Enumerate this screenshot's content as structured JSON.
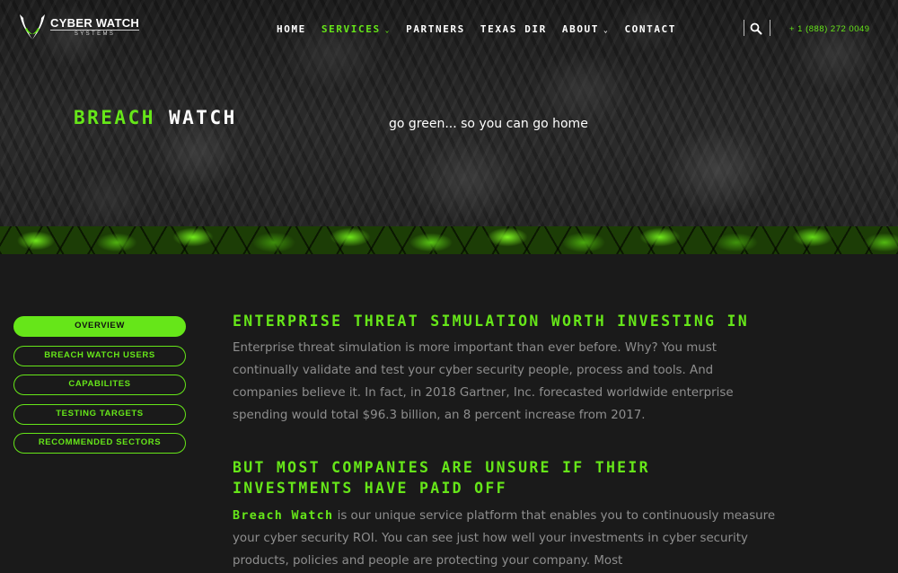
{
  "brand": {
    "name": "CYBER WATCH",
    "sub": "SYSTEMS",
    "accent": "#66e619"
  },
  "nav": {
    "items": [
      {
        "label": "HOME",
        "active": false,
        "dropdown": false
      },
      {
        "label": "SERVICES",
        "active": true,
        "dropdown": true
      },
      {
        "label": "PARTNERS",
        "active": false,
        "dropdown": false
      },
      {
        "label": "TEXAS DIR",
        "active": false,
        "dropdown": false
      },
      {
        "label": "ABOUT",
        "active": false,
        "dropdown": true
      },
      {
        "label": "CONTACT",
        "active": false,
        "dropdown": false
      }
    ],
    "search_icon": "search-icon",
    "phone": "+ 1 (888) 272 0049"
  },
  "hero": {
    "title_green": "BREACH",
    "title_white": "WATCH",
    "tagline": "go green... so you can go home"
  },
  "sidebar": {
    "items": [
      {
        "label": "OVERVIEW",
        "active": true
      },
      {
        "label": "BREACH WATCH USERS",
        "active": false
      },
      {
        "label": "CAPABILITES",
        "active": false
      },
      {
        "label": "TESTING TARGETS",
        "active": false
      },
      {
        "label": "RECOMMENDED SECTORS",
        "active": false
      }
    ]
  },
  "content": {
    "heading1": "ENTERPRISE THREAT SIMULATION WORTH INVESTING IN",
    "paragraph1": "Enterprise threat simulation is more important than ever before. Why? You must continually validate and test your cyber security people, process and tools. And companies believe it. In fact, in 2018 Gartner, Inc. forecasted worldwide enterprise spending would total $96.3 billion, an 8 percent increase from 2017.",
    "heading2_line1": "BUT MOST COMPANIES ARE UNSURE IF THEIR",
    "heading2_line2": "INVESTMENTS HAVE PAID OFF",
    "paragraph2_brand": "Breach Watch",
    "paragraph2": " is our unique service platform that enables you to continuously measure your cyber security ROI. You can see just how well your investments in cyber security products, policies and people are protecting your company. Most"
  }
}
